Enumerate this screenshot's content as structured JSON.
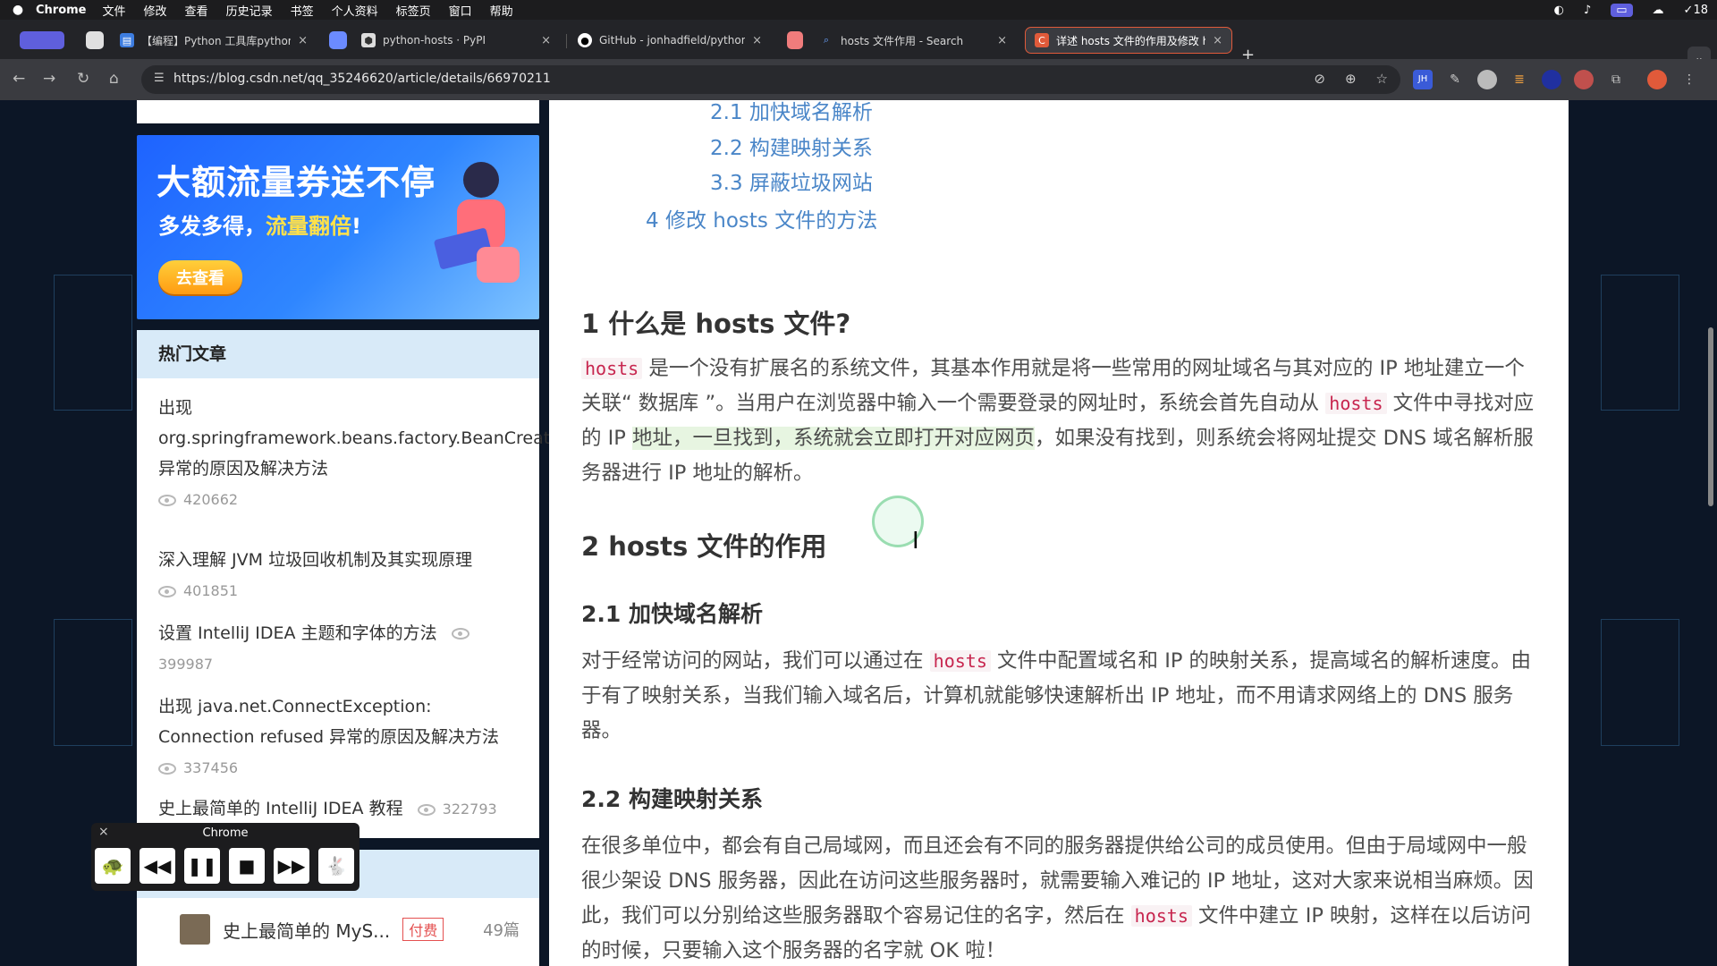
{
  "menubar": {
    "app_name": "Chrome",
    "items": [
      "文件",
      "修改",
      "查看",
      "历史记录",
      "书签",
      "个人资料",
      "标签页",
      "窗口",
      "帮助"
    ],
    "battery_text": "18"
  },
  "tabs": [
    {
      "title": "【编程】Python 工具库python-",
      "close": "×"
    },
    {
      "title": "python-hosts · PyPI",
      "close": "×"
    },
    {
      "title": "GitHub - jonhadfield/python-h",
      "close": "×"
    },
    {
      "title": "hosts 文件作用 - Search",
      "close": "×"
    },
    {
      "title": "详述 hosts 文件的作用及修改 h",
      "close": "×"
    }
  ],
  "address_bar": {
    "url": "https://blog.csdn.net/qq_35246620/article/details/66970211"
  },
  "banner": {
    "title": "大额流量券送不停",
    "subtitle_prefix": "多发多得，",
    "subtitle_highlight": "流量翻倍",
    "subtitle_suffix": "!",
    "button": "去查看"
  },
  "hot_articles": {
    "heading": "热门文章",
    "items": [
      {
        "title": "出现 org.springframework.beans.factory.BeanCreationException 异常的原因及解决方法",
        "views": "420662"
      },
      {
        "title": "深入理解 JVM 垃圾回收机制及其实现原理",
        "views": "401851"
      },
      {
        "title": "设置 IntelliJ IDEA 主题和字体的方法",
        "views": "399987"
      },
      {
        "title": "出现 java.net.ConnectException: Connection refused 异常的原因及解决方法",
        "views": "337456"
      },
      {
        "title": "史上最简单的 IntelliJ IDEA 教程",
        "views": "322793"
      }
    ]
  },
  "column": {
    "item_title": "史上最简单的 MyS...",
    "paid_badge": "付费",
    "count": "49篇"
  },
  "media_controller": {
    "title": "Chrome",
    "close": "×"
  },
  "toc": [
    "2.1 加快域名解析",
    "2.2 构建映射关系",
    "3.3 屏蔽垃圾网站",
    "4 修改 hosts 文件的方法"
  ],
  "article": {
    "s1_heading": "1 什么是 hosts 文件?",
    "s1_code": "hosts",
    "s1_p1": "是一个没有扩展名的系统文件，其基本作用就是将一些常用的网址域名与其对应的 IP 地址建立一个关联“ 数据库 ”。当用户在浏览器中输入一个需要登录的网址时，系统会首先自动从",
    "s1_code2": "hosts",
    "s1_p2": "文件中寻找对应的 IP",
    "s1_hl": "地址，一旦找到，系统就会立即打开对应网页",
    "s1_p3": "，如果没有找到，则系统会将网址提交 DNS 域名解析服务器进行 IP 地址的解析。",
    "s2_heading": "2 hosts 文件的作用",
    "s21_heading": "2.1 加快域名解析",
    "s21_p1": "对于经常访问的网站，我们可以通过在",
    "s21_code": "hosts",
    "s21_p2": "文件中配置域名和 IP 的映射关系，提高域名的解析速度。由于有了映射关系，当我们输入域名后，计算机就能够快速解析出 IP 地址，而不用请求网络上的 DNS 服务器。",
    "s22_heading": "2.2 构建映射关系",
    "s22_p1": "在很多单位中，都会有自己局域网，而且还会有不同的服务器提供给公司的成员使用。但由于局域网中一般很少架设 DNS 服务器，因此在访问这些服务器时，就需要输入难记的 IP 地址，这对大家来说相当麻烦。因此，我们可以分别给这些服务器取个容易记住的名字，然后在",
    "s22_code": "hosts",
    "s22_p2": "文件中建立 IP 映射，这样在以后访问的时候，只要输入这个服务器的名字就 OK 啦！"
  },
  "colors": {
    "accent_tab_border": "#e05a3a",
    "toc_link": "#4a86c8",
    "code_text": "#c7254e",
    "highlight": "#e7f5e1"
  }
}
